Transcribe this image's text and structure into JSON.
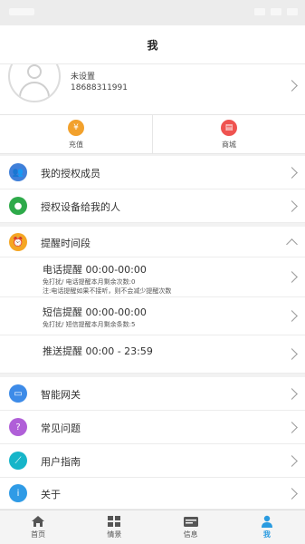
{
  "page": {
    "title": "我"
  },
  "profile": {
    "name": "未设置",
    "phone": "18688311991"
  },
  "quick_actions": [
    {
      "label": "充值",
      "icon": "yen-coin-icon",
      "color": "#f2a12c"
    },
    {
      "label": "商城",
      "icon": "shop-icon",
      "color": "#ef5350"
    }
  ],
  "menu_top": [
    {
      "label": "我的授权成员",
      "icon": "members-icon",
      "color": "#3f7fd9"
    },
    {
      "label": "授权设备给我的人",
      "icon": "person-icon",
      "color": "#2eaa4a"
    }
  ],
  "reminder": {
    "label": "提醒时间段",
    "icon": "alarm-clock-icon",
    "color": "#f5a623",
    "items": [
      {
        "title": "电话提醒   00:00-00:00",
        "desc1": "免打扰/ 电话提醒本月剩余次数:0",
        "desc2": "注:电话提醒如果不接听，则不会减少提醒次数"
      },
      {
        "title": "短信提醒   00:00-00:00",
        "desc1": "免打扰/ 短信提醒本月剩余条数:5"
      },
      {
        "title": "推送提醒   00:00 - 23:59"
      }
    ]
  },
  "menu_bottom": [
    {
      "label": "智能网关",
      "icon": "gateway-icon",
      "color": "#3d8be8"
    },
    {
      "label": "常见问题",
      "icon": "question-icon",
      "color": "#b05fd8"
    },
    {
      "label": "用户指南",
      "icon": "guide-icon",
      "color": "#16b5c9"
    },
    {
      "label": "关于",
      "icon": "info-icon",
      "color": "#2f9be6"
    }
  ],
  "tabs": [
    {
      "label": "首页",
      "icon": "home-icon"
    },
    {
      "label": "情景",
      "icon": "scene-icon"
    },
    {
      "label": "信息",
      "icon": "message-icon"
    },
    {
      "label": "我",
      "icon": "user-icon",
      "active": true
    }
  ],
  "colors": {
    "accent": "#2a9be0",
    "background": "#f2f2f2"
  }
}
